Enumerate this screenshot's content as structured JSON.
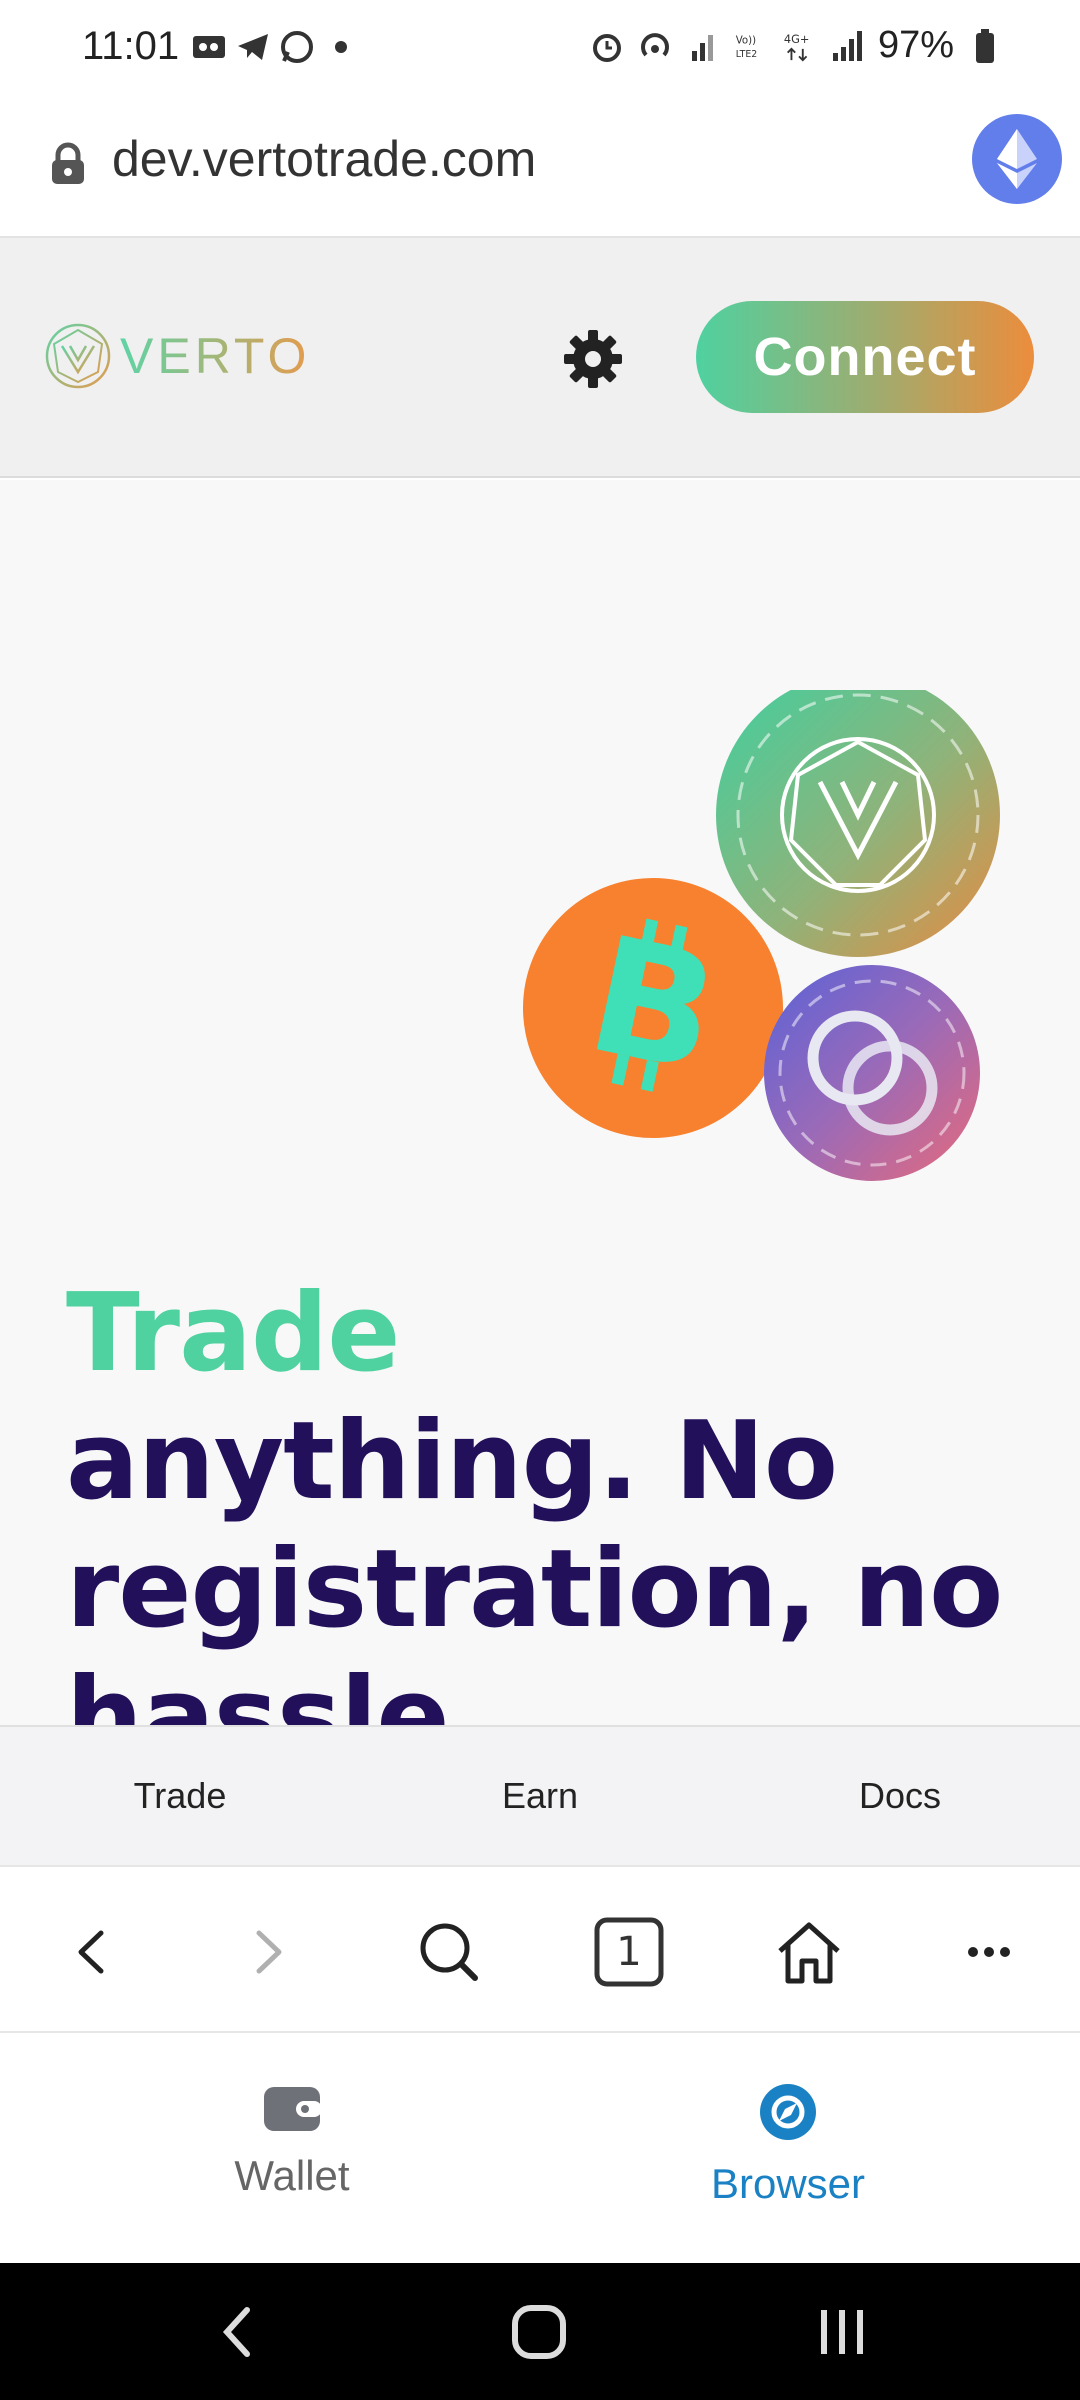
{
  "status_bar": {
    "time": "11:01",
    "battery": "97%"
  },
  "browser": {
    "url": "dev.vertotrade.com",
    "tab_count": "1"
  },
  "site_header": {
    "logo_text": "VERTO",
    "connect_label": "Connect"
  },
  "hero": {
    "title_accent": "Trade",
    "title_rest": "anything. No registration, no hassle."
  },
  "site_nav": {
    "items": [
      {
        "label": "Trade"
      },
      {
        "label": "Earn"
      },
      {
        "label": "Docs"
      }
    ]
  },
  "app_tabs": {
    "wallet_label": "Wallet",
    "browser_label": "Browser"
  },
  "colors": {
    "accent_green": "#4fd1a0",
    "accent_orange": "#ec8d3c",
    "title_navy": "#22105a",
    "browser_active_blue": "#1a82c4"
  }
}
